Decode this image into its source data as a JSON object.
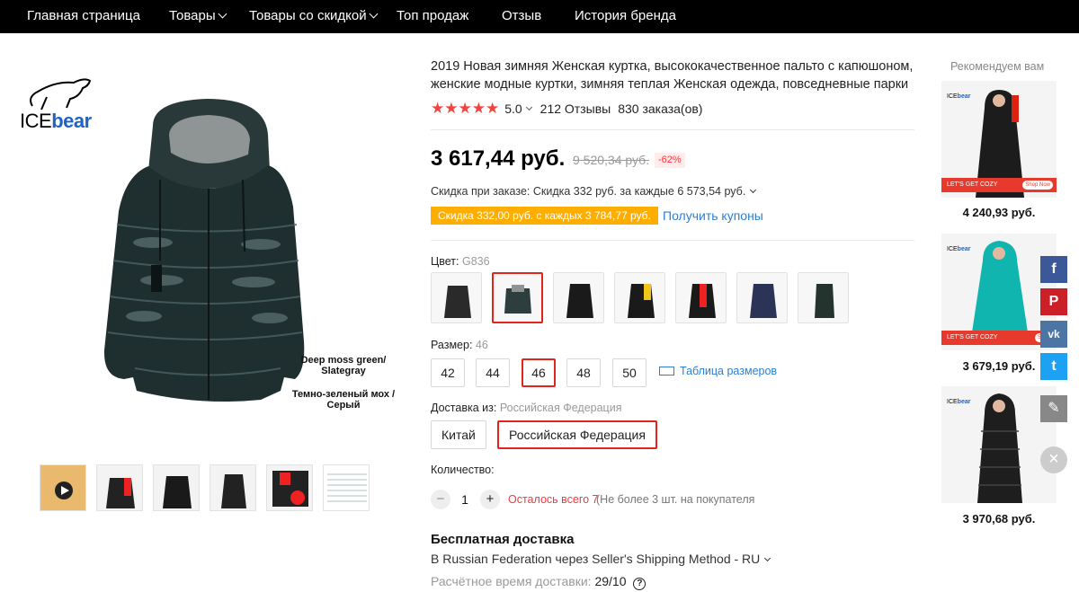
{
  "nav": {
    "items": [
      {
        "label": "Главная страница",
        "dropdown": false
      },
      {
        "label": "Товары",
        "dropdown": true
      },
      {
        "label": "Товары со скидкой",
        "dropdown": true
      },
      {
        "label": "Топ продаж",
        "dropdown": false
      },
      {
        "label": "Отзыв",
        "dropdown": false
      },
      {
        "label": "История бренда",
        "dropdown": false
      }
    ]
  },
  "gallery": {
    "logo_ice": "ICE",
    "logo_bear": "bear",
    "caption_en": "Deep moss green/ Slategray",
    "caption_ru": "Темно-зеленый мох / Серый"
  },
  "product": {
    "title": "2019 Новая зимняя Женская куртка, высококачественное пальто с капюшоном, женские модные куртки, зимняя теплая Женская одежда, повседневные парки",
    "stars": "★★★★★",
    "rating": "5.0",
    "reviews": "212 Отзывы",
    "orders": "830 заказа(ов)",
    "price": "3 617,44 руб.",
    "old_price": "9 520,34 руб.",
    "discount": "-62%",
    "order_discount": "Скидка при заказе: Скидка 332 руб. за каждые 6 573,54 руб.",
    "coupon_tag": "Скидка 332,00 руб. с каждых 3 784,77 руб.",
    "coupon_link": "Получить купоны"
  },
  "color": {
    "label": "Цвет:",
    "value": "G836",
    "options": [
      "dark",
      "green-selected",
      "black",
      "yellow",
      "red",
      "navy",
      "moss"
    ]
  },
  "size": {
    "label": "Размер:",
    "value": "46",
    "options": [
      "42",
      "44",
      "46",
      "48",
      "50"
    ],
    "table_link": "Таблица размеров"
  },
  "ship_from": {
    "label": "Доставка из:",
    "value": "Российская Федерация",
    "options": [
      "Китай",
      "Российская Федерация"
    ]
  },
  "quantity": {
    "label": "Количество:",
    "minus": "−",
    "plus": "+",
    "value": "1",
    "left": "Осталось всего 7",
    "limit": "(Не более 3 шт. на покупателя"
  },
  "shipping": {
    "free": "Бесплатная доставка",
    "method": "В Russian Federation через Seller's Shipping Method - RU",
    "time_label": "Расчётное время доставки:",
    "time_value": "29/10",
    "help": "?"
  },
  "recommend": {
    "title": "Рекомендуем вам",
    "items": [
      {
        "price": "4 240,93 руб.",
        "banner": "LET'S GET COZY",
        "shop": "Shop Now",
        "brand_ice": "ICE",
        "brand_bear": "bear"
      },
      {
        "price": "3 679,19 руб.",
        "banner": "LET'S GET COZY",
        "shop": "Shop",
        "brand_ice": "ICE",
        "brand_bear": "bear"
      },
      {
        "price": "3 970,68 руб.",
        "brand_ice": "ICE",
        "brand_bear": "bear"
      }
    ]
  },
  "social": {
    "facebook": "f",
    "pinterest": "P",
    "vk": "vk",
    "twitter": "t",
    "edit": "✎",
    "close": "×"
  },
  "colors": {
    "accent": "#e1251b",
    "link": "#2a7fd4",
    "coupon": "#ffae00",
    "star": "#f2443e"
  }
}
